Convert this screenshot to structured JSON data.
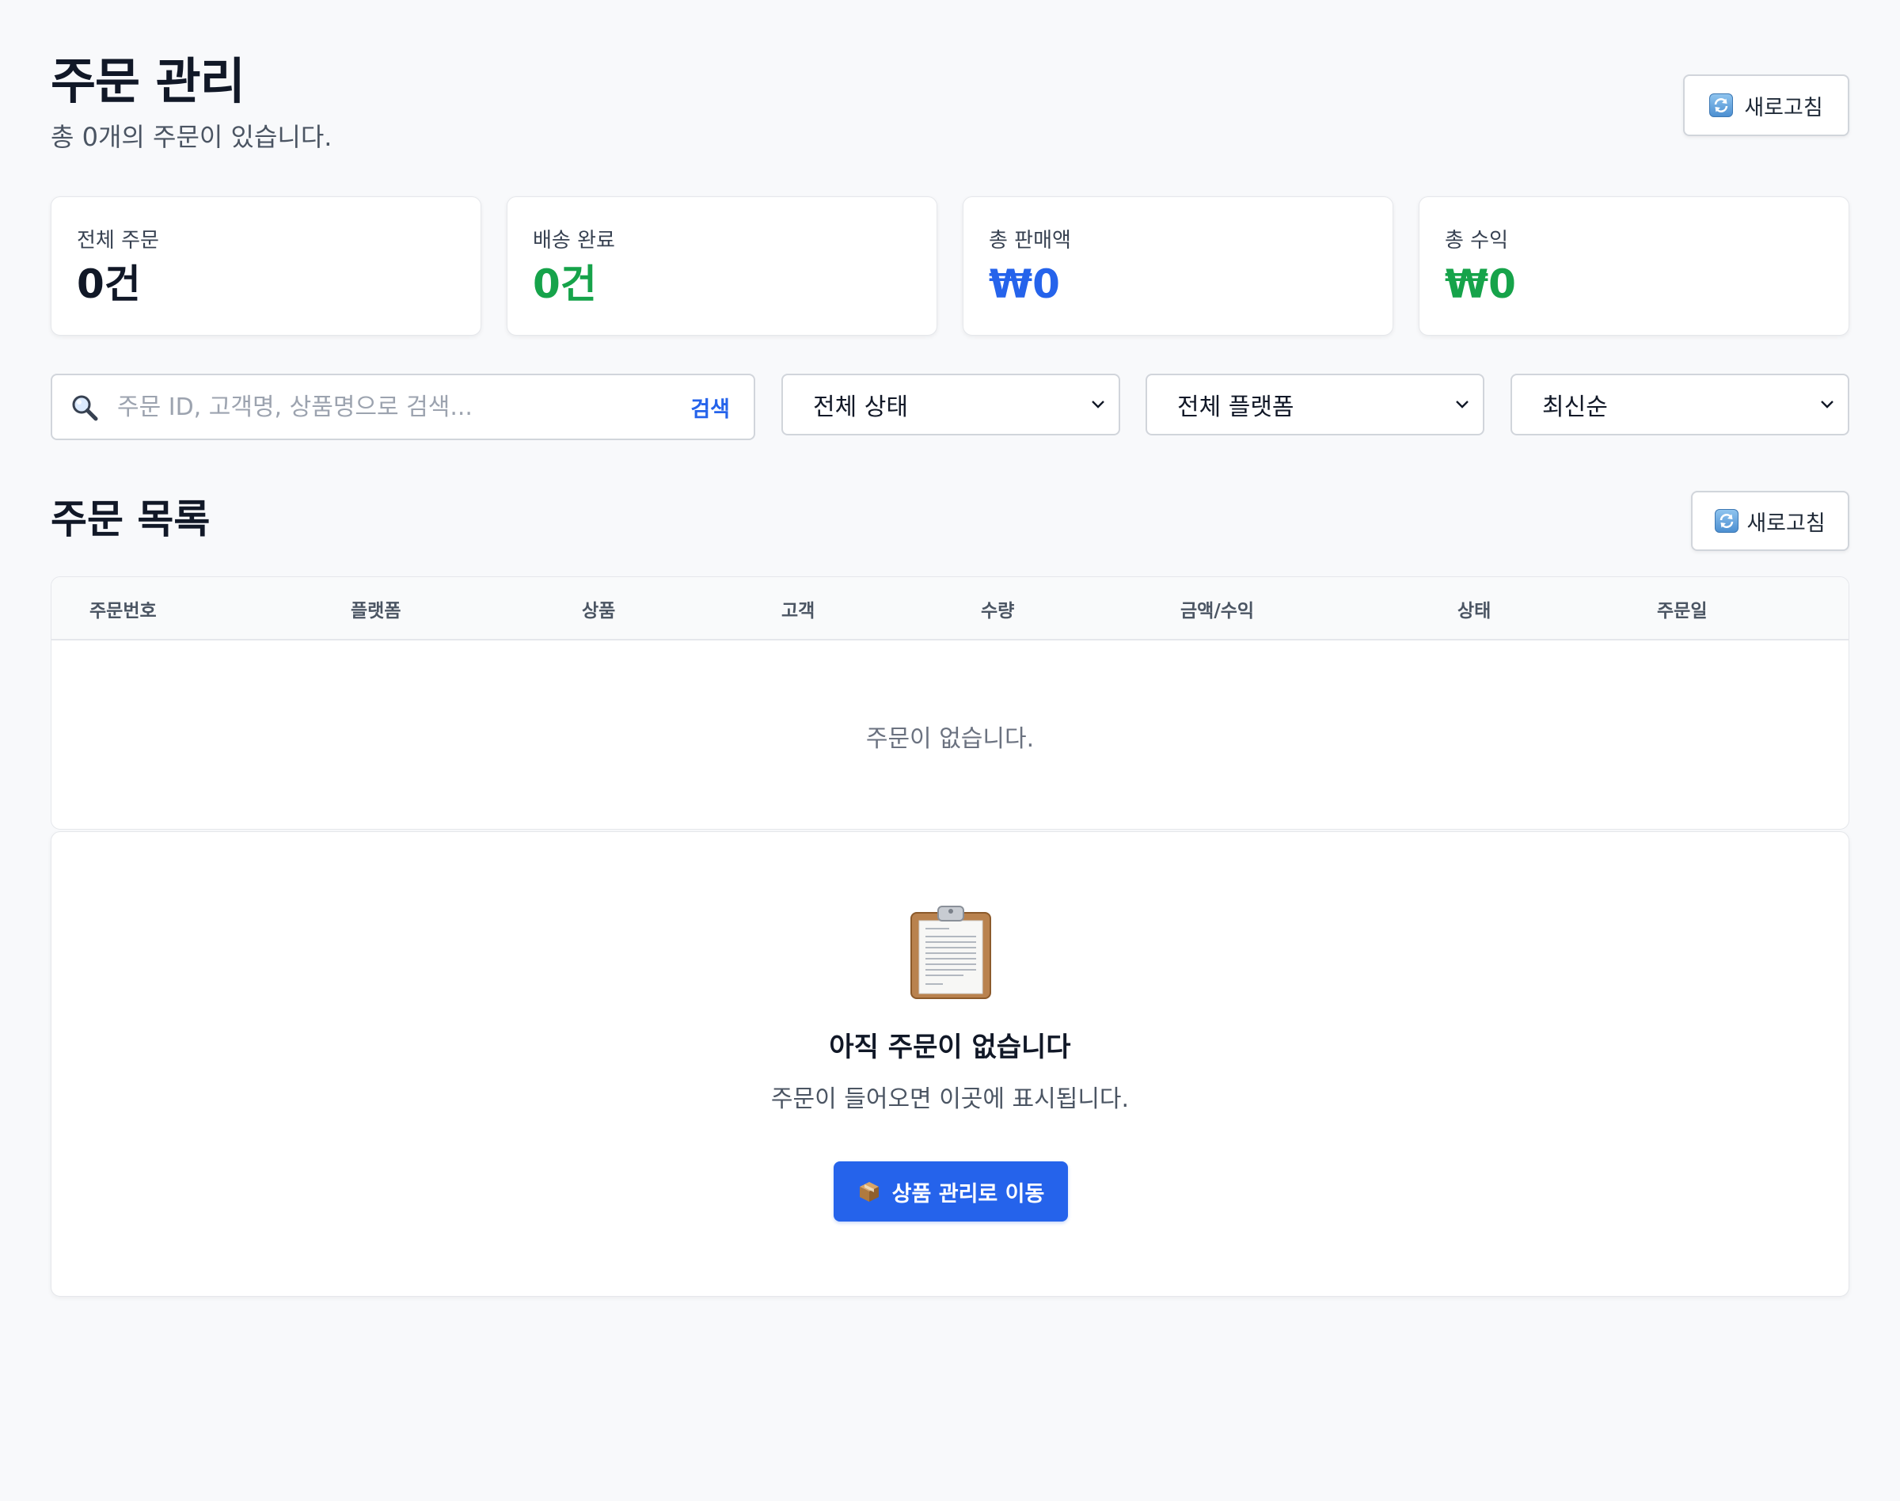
{
  "header": {
    "title": "주문 관리",
    "subtitle": "총 0개의 주문이 있습니다.",
    "refresh_label": "새로고침"
  },
  "stats": [
    {
      "label": "전체 주문",
      "value": "0건",
      "color": "#111827"
    },
    {
      "label": "배송 완료",
      "value": "0건",
      "color": "#16a34a"
    },
    {
      "label": "총 판매액",
      "value": "₩0",
      "color": "#2563eb"
    },
    {
      "label": "총 수익",
      "value": "₩0",
      "color": "#16a34a"
    }
  ],
  "filters": {
    "search": {
      "placeholder": "주문 ID, 고객명, 상품명으로 검색...",
      "value": "",
      "button_label": "검색"
    },
    "status_select": "전체 상태",
    "platform_select": "전체 플랫폼",
    "sort_select": "최신순"
  },
  "orders": {
    "title": "주문 목록",
    "refresh_label": "새로고침",
    "columns": [
      "주문번호",
      "플랫폼",
      "상품",
      "고객",
      "수량",
      "금액/수익",
      "상태",
      "주문일"
    ],
    "empty_message": "주문이 없습니다."
  },
  "empty_state": {
    "icon": "clipboard-icon",
    "title": "아직 주문이 없습니다",
    "description": "주문이 들어오면 이곳에 표시됩니다.",
    "button_label": "상품 관리로 이동",
    "button_icon": "package-icon",
    "button_color": "#2563eb"
  }
}
